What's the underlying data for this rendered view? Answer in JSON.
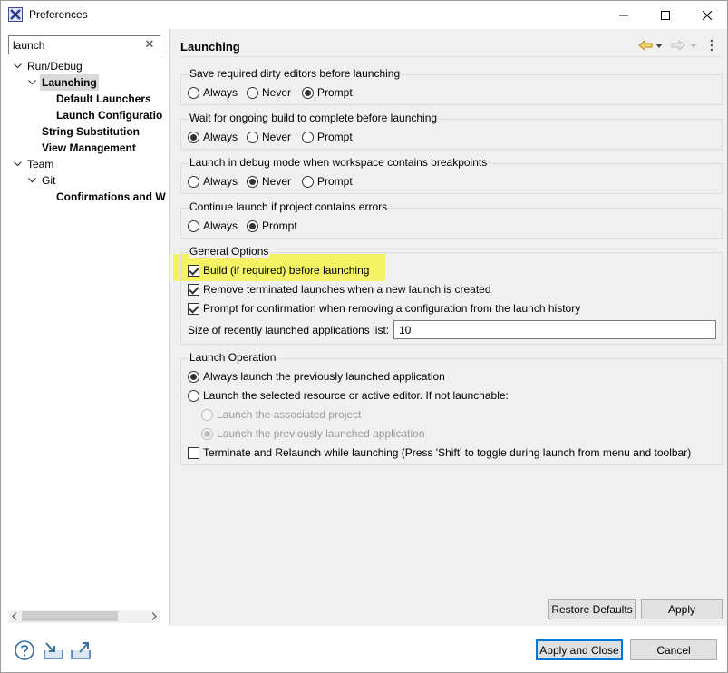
{
  "window": {
    "title": "Preferences",
    "minimize_label": "Minimize",
    "maximize_label": "Maximize",
    "close_label": "Close"
  },
  "filter": {
    "value": "launch",
    "clear_symbol": "✕"
  },
  "tree": [
    {
      "label": "Run/Debug",
      "level": 0,
      "expanded": true,
      "bold": false,
      "selected": false
    },
    {
      "label": "Launching",
      "level": 1,
      "expanded": true,
      "bold": true,
      "selected": true
    },
    {
      "label": "Default Launchers",
      "level": 2,
      "bold": true
    },
    {
      "label": "Launch Configuratio",
      "level": 2,
      "bold": true
    },
    {
      "label": "String Substitution",
      "level": 1,
      "bold": true
    },
    {
      "label": "View Management",
      "level": 1,
      "bold": true
    },
    {
      "label": "Team",
      "level": 0,
      "expanded": true,
      "bold": false
    },
    {
      "label": "Git",
      "level": 1,
      "expanded": true,
      "bold": false
    },
    {
      "label": "Confirmations and W",
      "level": 2,
      "bold": true
    }
  ],
  "page": {
    "title": "Launching",
    "groups": {
      "save_dirty": {
        "label": "Save required dirty editors before launching",
        "options": [
          "Always",
          "Never",
          "Prompt"
        ],
        "selected": "Prompt"
      },
      "wait_build": {
        "label": "Wait for ongoing build to complete before launching",
        "options": [
          "Always",
          "Never",
          "Prompt"
        ],
        "selected": "Always"
      },
      "debug_mode": {
        "label": "Launch in debug mode when workspace contains breakpoints",
        "options": [
          "Always",
          "Never",
          "Prompt"
        ],
        "selected": "Never"
      },
      "continue_errors": {
        "label": "Continue launch if project contains errors",
        "options": [
          "Always",
          "Prompt"
        ],
        "selected": "Prompt"
      },
      "general": {
        "label": "General Options",
        "build_before": {
          "label": "Build (if required) before launching",
          "checked": true
        },
        "remove_terminated": {
          "label": "Remove terminated launches when a new launch is created",
          "checked": true
        },
        "prompt_remove": {
          "label": "Prompt for confirmation when removing a configuration from the launch history",
          "checked": true
        },
        "size_label": "Size of recently launched applications list:",
        "size_value": "10"
      },
      "launch_operation": {
        "label": "Launch Operation",
        "always_previous": {
          "label": "Always launch the previously launched application",
          "selected": true
        },
        "selected_resource": {
          "label": "Launch the selected resource or active editor. If not launchable:",
          "selected": false
        },
        "associated_project": {
          "label": "Launch the associated project",
          "selected": false,
          "enabled": false
        },
        "previously_launched": {
          "label": "Launch the previously launched application",
          "selected": true,
          "enabled": false
        },
        "terminate_relaunch": {
          "label": "Terminate and Relaunch while launching (Press 'Shift' to toggle during launch from menu and toolbar)",
          "checked": false
        }
      }
    },
    "restore_defaults_label": "Restore Defaults",
    "apply_label": "Apply"
  },
  "footer": {
    "apply_close_label": "Apply and Close",
    "cancel_label": "Cancel"
  },
  "colors": {
    "highlight": "#f3f363",
    "accent": "#0078d7",
    "pane_bg": "#f0f0f0"
  }
}
